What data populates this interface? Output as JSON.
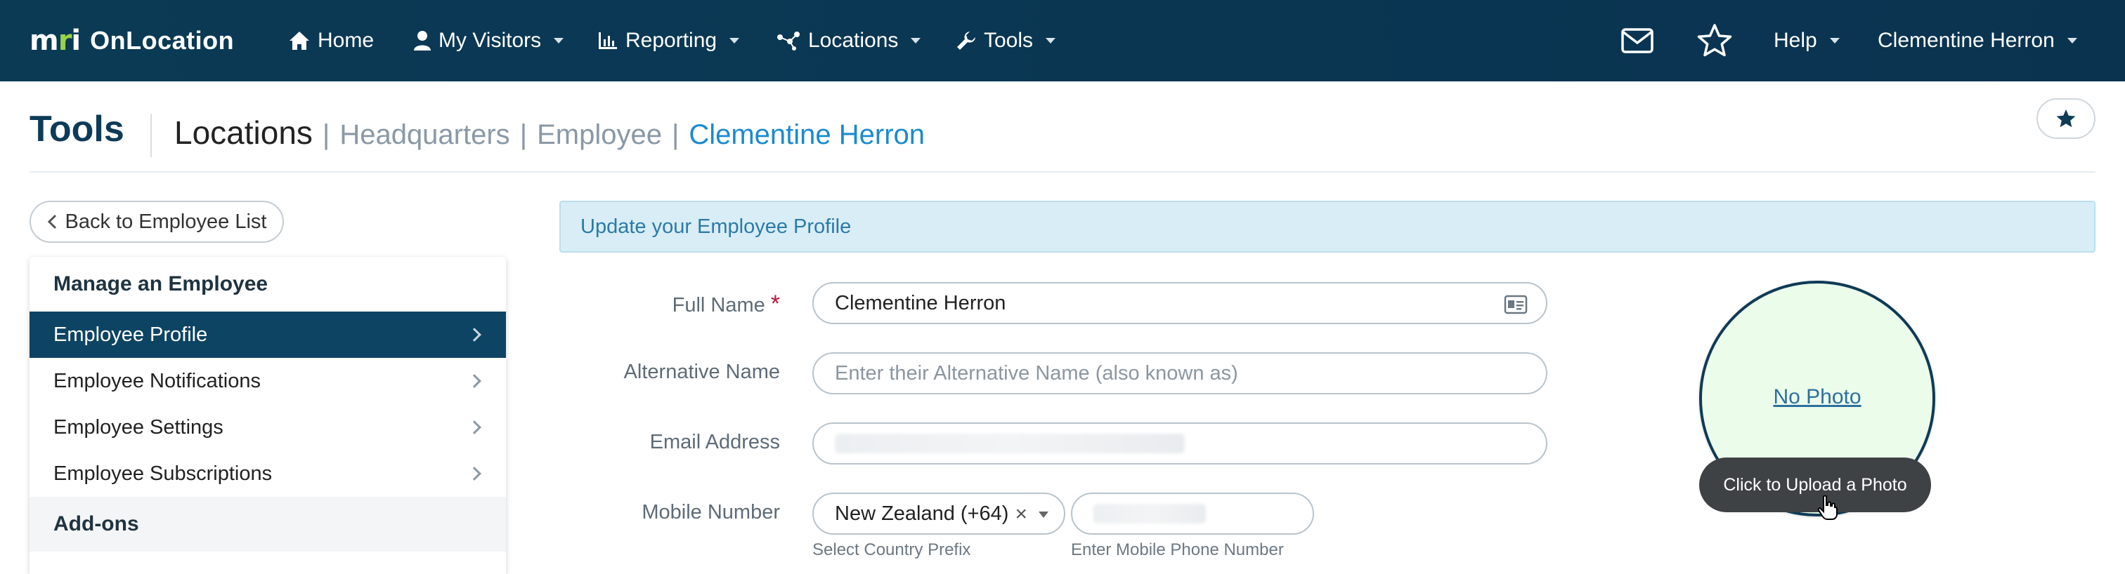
{
  "nav": {
    "brand_logo": "mri",
    "brand_name": "OnLocation",
    "items": [
      {
        "label": "Home",
        "icon": "home-icon"
      },
      {
        "label": "My Visitors",
        "icon": "user-icon"
      },
      {
        "label": "Reporting",
        "icon": "chart-icon"
      },
      {
        "label": "Locations",
        "icon": "nodes-icon"
      },
      {
        "label": "Tools",
        "icon": "wrench-icon"
      }
    ],
    "help_label": "Help",
    "user_label": "Clementine Herron"
  },
  "header": {
    "title": "Tools",
    "breadcrumb": {
      "root": "Locations",
      "sep": "|",
      "level1": "Headquarters",
      "level2": "Employee",
      "current": "Clementine Herron"
    }
  },
  "sidebar": {
    "back_label": "Back to Employee List",
    "section_title": "Manage an Employee",
    "items": [
      {
        "label": "Employee Profile",
        "active": true
      },
      {
        "label": "Employee Notifications"
      },
      {
        "label": "Employee Settings"
      },
      {
        "label": "Employee Subscriptions"
      }
    ],
    "addons_title": "Add-ons"
  },
  "main": {
    "banner": "Update your Employee Profile",
    "fields": {
      "full_name": {
        "label": "Full Name",
        "required_mark": "*",
        "value": "Clementine Herron"
      },
      "alt_name": {
        "label": "Alternative Name",
        "placeholder": "Enter their Alternative Name (also known as)"
      },
      "email": {
        "label": "Email Address"
      },
      "mobile": {
        "label": "Mobile Number",
        "country_value": "New Zealand (+64)",
        "clear_symbol": "×",
        "country_hint": "Select Country Prefix",
        "number_hint": "Enter Mobile Phone Number"
      }
    },
    "photo": {
      "link_label": "No Photo",
      "upload_label": "Click to Upload a Photo"
    }
  },
  "colors": {
    "nav_bg": "#0b3a55",
    "active_item": "#0e4463",
    "accent_link": "#1b8ad0",
    "banner_bg": "#d9edf7",
    "photo_bg": "#ebfdea"
  }
}
